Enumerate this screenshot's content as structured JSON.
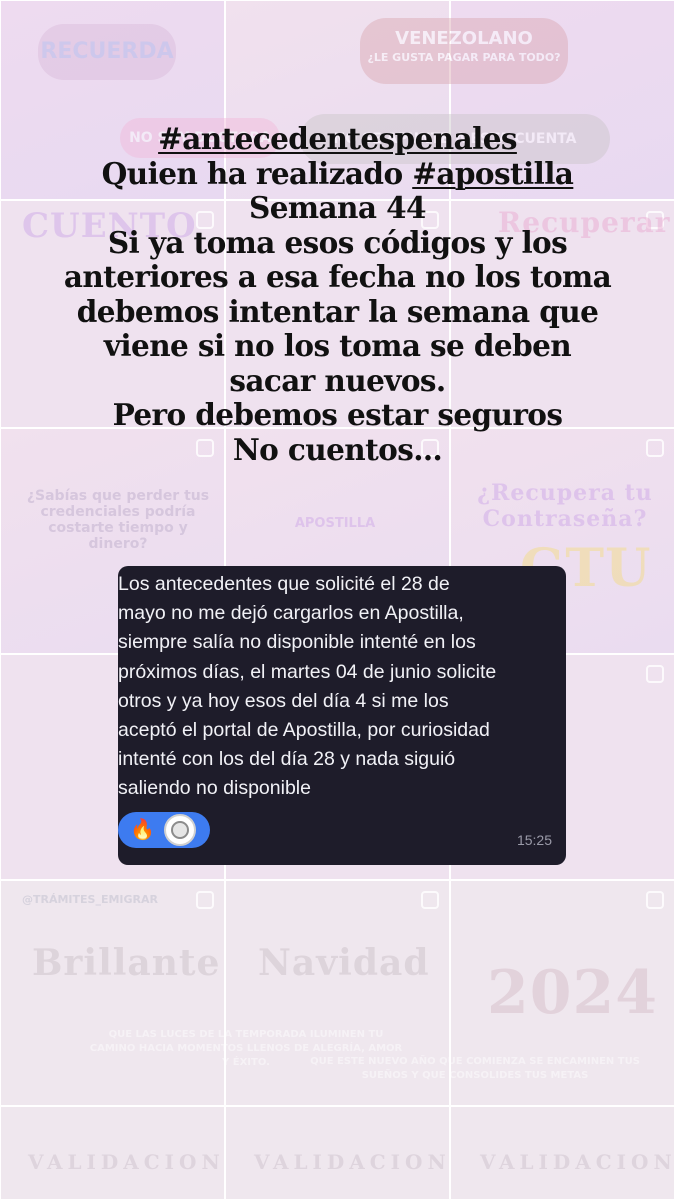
{
  "headline": {
    "line1": "#antecedentespenales",
    "line2_prefix": "Quien ha realizado ",
    "line2_tag": "#apostilla",
    "line3": "Semana 44",
    "line4": "Si ya toma esos códigos y los",
    "line5": "anteriores a esa fecha no los toma",
    "line6": "debemos intentar la semana que",
    "line7": "viene si no los toma se deben",
    "line8": "sacar nuevos.",
    "line9": "Pero debemos estar seguros",
    "line10": "No cuentos…"
  },
  "message": {
    "lines": [
      "Los antecedentes que solicité el 28 de",
      "mayo no me dejó cargarlos en Apostilla,",
      "siempre salía no disponible intenté en los",
      "próximos días, el martes 04 de junio solicite",
      "otros y ya hoy esos del día 4 si me los",
      "aceptó el portal de Apostilla, por curiosidad",
      "intenté con los del día 28 y nada siguió",
      "saliendo no disponible"
    ],
    "reaction_emoji": "🔥",
    "time": "15:25"
  },
  "background": {
    "pill_recuerda": "RECUERDA",
    "pill_venezolano": "VENEZOLANO",
    "pill_venezolano_sub": "¿LE GUSTA PAGAR PARA TODO?",
    "pill_gray": "NO SE APUNTE A ESTA CUENTA",
    "pill_pink": "NO SOY DOCTORA",
    "tile_cuento": "CUENTO",
    "tile_recuperar": "Recuperar",
    "tile_sabias": "¿Sabías que perder tus credenciales podría costarte tiempo y dinero?",
    "tile_recupera_contrasena": "¿Recupera tu Contraseña?",
    "tile_saime": "GTU",
    "tile_apostilla": "APOSTILLA",
    "tile_brillante": "Brillante",
    "tile_navidad": "Navidad",
    "tile_2024": "2024",
    "tile_luces": "QUE LAS LUCES DE LA TEMPORADA ILUMINEN TU CAMINO HACIA MOMENTOS LLENOS DE ALEGRÍA, AMOR Y ÉXITO.",
    "tile_nuevo_anio": "QUE ESTE NUEVO AÑO QUE COMIENZA SE ENCAMINEN TUS SUEÑOS Y QUE CONSOLIDES TUS METAS",
    "tile_validacion": "VALIDACION",
    "tile_handle": "@TRÁMITES_EMIGRAR"
  },
  "colors": {
    "message_bg": "#1e1c2a",
    "reaction_pill": "#3d7bf0",
    "headline_text": "#111111"
  }
}
